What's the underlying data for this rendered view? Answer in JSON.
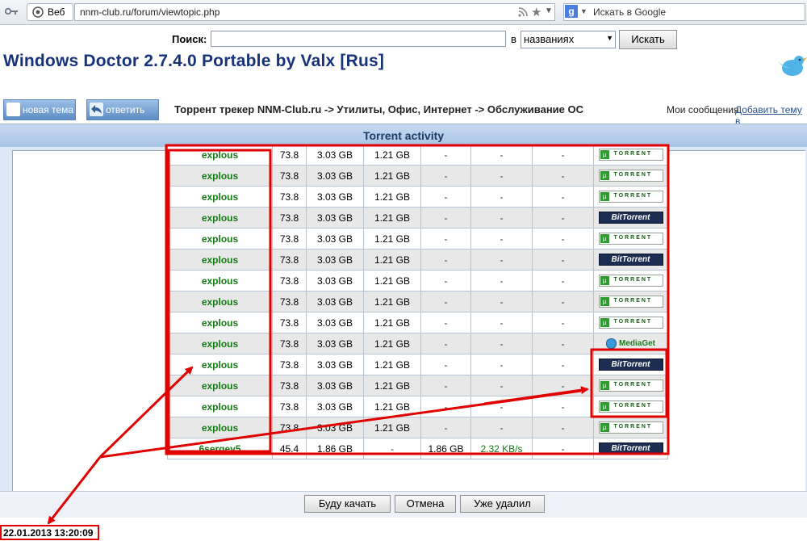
{
  "browser": {
    "web_button_label": "Веб",
    "url": "nnm-club.ru/forum/viewtopic.php",
    "search_engine_icon": "google-icon",
    "search_placeholder": "Искать в Google"
  },
  "site_search": {
    "label": "Поиск:",
    "in_label": "в",
    "scope_value": "названиях",
    "button_label": "Искать"
  },
  "topic": {
    "title": "Windows Doctor 2.7.4.0 Portable by Valx [Rus]"
  },
  "nav": {
    "new_topic_label": "новая тема",
    "reply_label": "ответить",
    "breadcrumb": "Торрент трекер NNM-Club.ru -> Утилиты, Офис, Интернет -> Обслуживание ОС",
    "my_messages": "Мои сообщения",
    "add_topic_link": "Добавить тему в"
  },
  "activity": {
    "title": "Torrent activity",
    "rows": [
      {
        "user": "explous",
        "ratio": "73.8",
        "up": "3.03 GB",
        "down": "1.21 GB",
        "c1": "-",
        "c2": "-",
        "c3": "-",
        "client": "utorrent",
        "alt": false
      },
      {
        "user": "explous",
        "ratio": "73.8",
        "up": "3.03 GB",
        "down": "1.21 GB",
        "c1": "-",
        "c2": "-",
        "c3": "-",
        "client": "utorrent",
        "alt": true
      },
      {
        "user": "explous",
        "ratio": "73.8",
        "up": "3.03 GB",
        "down": "1.21 GB",
        "c1": "-",
        "c2": "-",
        "c3": "-",
        "client": "utorrent",
        "alt": false
      },
      {
        "user": "explous",
        "ratio": "73.8",
        "up": "3.03 GB",
        "down": "1.21 GB",
        "c1": "-",
        "c2": "-",
        "c3": "-",
        "client": "bittorrent",
        "alt": true
      },
      {
        "user": "explous",
        "ratio": "73.8",
        "up": "3.03 GB",
        "down": "1.21 GB",
        "c1": "-",
        "c2": "-",
        "c3": "-",
        "client": "utorrent",
        "alt": false
      },
      {
        "user": "explous",
        "ratio": "73.8",
        "up": "3.03 GB",
        "down": "1.21 GB",
        "c1": "-",
        "c2": "-",
        "c3": "-",
        "client": "bittorrent",
        "alt": true
      },
      {
        "user": "explous",
        "ratio": "73.8",
        "up": "3.03 GB",
        "down": "1.21 GB",
        "c1": "-",
        "c2": "-",
        "c3": "-",
        "client": "utorrent",
        "alt": false
      },
      {
        "user": "explous",
        "ratio": "73.8",
        "up": "3.03 GB",
        "down": "1.21 GB",
        "c1": "-",
        "c2": "-",
        "c3": "-",
        "client": "utorrent",
        "alt": true
      },
      {
        "user": "explous",
        "ratio": "73.8",
        "up": "3.03 GB",
        "down": "1.21 GB",
        "c1": "-",
        "c2": "-",
        "c3": "-",
        "client": "utorrent",
        "alt": false
      },
      {
        "user": "explous",
        "ratio": "73.8",
        "up": "3.03 GB",
        "down": "1.21 GB",
        "c1": "-",
        "c2": "-",
        "c3": "-",
        "client": "mediaget",
        "alt": true
      },
      {
        "user": "explous",
        "ratio": "73.8",
        "up": "3.03 GB",
        "down": "1.21 GB",
        "c1": "-",
        "c2": "-",
        "c3": "-",
        "client": "bittorrent",
        "alt": false
      },
      {
        "user": "explous",
        "ratio": "73.8",
        "up": "3.03 GB",
        "down": "1.21 GB",
        "c1": "-",
        "c2": "-",
        "c3": "-",
        "client": "utorrent",
        "alt": true
      },
      {
        "user": "explous",
        "ratio": "73.8",
        "up": "3.03 GB",
        "down": "1.21 GB",
        "c1": "-",
        "c2": "-",
        "c3": "-",
        "client": "utorrent",
        "alt": false
      },
      {
        "user": "explous",
        "ratio": "73.8",
        "up": "3.03 GB",
        "down": "1.21 GB",
        "c1": "-",
        "c2": "-",
        "c3": "-",
        "client": "utorrent",
        "alt": true
      },
      {
        "user": "6sergey5",
        "ratio": "45.4",
        "up": "1.86 GB",
        "down": "-",
        "c1": "1.86 GB",
        "c2": "2.32 KB/s",
        "c3": "-",
        "client": "bittorrent",
        "alt": false
      }
    ],
    "client_labels": {
      "utorrent_mark": "µ",
      "utorrent_text": "TORRENT",
      "bittorrent_text": "BitTorrent",
      "mediaget_text": "MediaGet"
    }
  },
  "footer": {
    "will_download": "Буду качать",
    "cancel": "Отмена",
    "already_deleted": "Уже удалил"
  },
  "timestamp": "22.01.2013 13:20:09",
  "colors": {
    "annotation_red": "#e00000",
    "username_green": "#137a13",
    "header_blue": "#a8c3e4"
  }
}
